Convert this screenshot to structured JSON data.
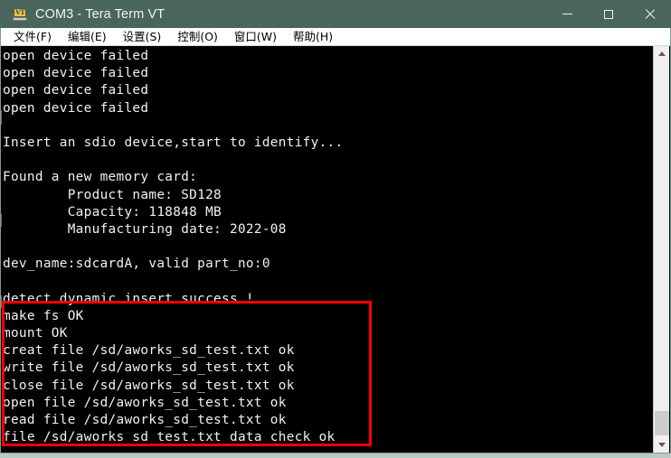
{
  "window": {
    "title": "COM3 - Tera Term VT",
    "icon": "terminal-vt-icon",
    "icon_label": "VT",
    "controls": {
      "minimize": "—",
      "maximize": "☐",
      "close": "✕"
    },
    "colors": {
      "titlebar": "#4a655c",
      "titlebar_text": "#f2f4f3",
      "menubar": "#ffffff",
      "terminal_bg": "#000000",
      "terminal_fg": "#f1f1f1",
      "annotation": "#ff0000",
      "scrollbar_track": "#f0f0f0",
      "scrollbar_thumb": "#cdcdcd",
      "window_edge": "#7f9a91"
    }
  },
  "menubar": {
    "items": [
      {
        "label": "文件",
        "mnemonic": "F",
        "full": "文件(F)"
      },
      {
        "label": "编辑",
        "mnemonic": "E",
        "full": "编辑(E)"
      },
      {
        "label": "设置",
        "mnemonic": "S",
        "full": "设置(S)"
      },
      {
        "label": "控制",
        "mnemonic": "O",
        "full": "控制(O)"
      },
      {
        "label": "窗口",
        "mnemonic": "W",
        "full": "窗口(W)"
      },
      {
        "label": "帮助",
        "mnemonic": "H",
        "full": "帮助(H)"
      }
    ]
  },
  "terminal": {
    "lines": [
      "open device failed",
      "open device failed",
      "open device failed",
      "open device failed",
      "",
      "Insert an sdio device,start to identify...",
      "",
      "Found a new memory card:",
      "        Product name: SD128",
      "        Capacity: 118848 MB",
      "        Manufacturing date: 2022-08",
      "",
      "dev_name:sdcardA, valid part_no:0",
      "",
      "detect dynamic insert success !",
      "make fs OK",
      "mount OK",
      "creat file /sd/aworks_sd_test.txt ok",
      "write file /sd/aworks_sd_test.txt ok",
      "close file /sd/aworks_sd_test.txt ok",
      "open file /sd/aworks_sd_test.txt ok",
      "read file /sd/aworks_sd_test.txt ok",
      "file /sd/aworks_sd_test.txt data check ok"
    ],
    "card_info": {
      "product_name": "SD128",
      "capacity": "118848 MB",
      "manufacturing_date": "2022-08",
      "dev_name": "sdcardA",
      "part_no": "0"
    },
    "highlight_note": "make fs OK … file /sd/aworks_sd_test.txt data check ok"
  },
  "scrollbar": {
    "up_arrow": "▲",
    "down_arrow": "▼",
    "position": "bottom"
  }
}
